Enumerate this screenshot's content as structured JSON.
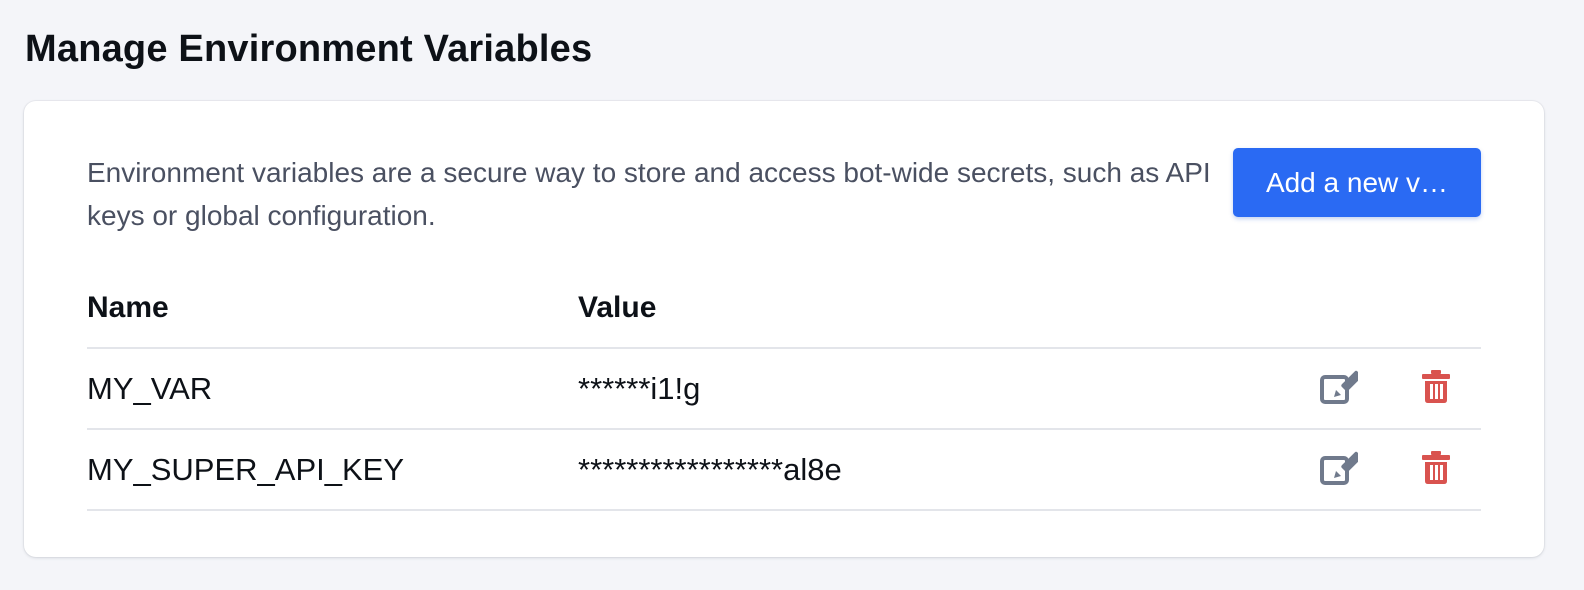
{
  "page": {
    "title": "Manage Environment Variables"
  },
  "panel": {
    "description": "Environment variables are a secure way to store and access bot-wide secrets, such as API keys or global configuration.",
    "add_button_label": "Add a new v…"
  },
  "table": {
    "columns": {
      "name": "Name",
      "value": "Value"
    },
    "rows": [
      {
        "name": "MY_VAR",
        "value": "******i1!g"
      },
      {
        "name": "MY_SUPER_API_KEY",
        "value": "*****************al8e"
      }
    ]
  },
  "icons": {
    "edit": "edit-icon",
    "delete": "trash-icon"
  },
  "colors": {
    "page_background": "#f4f5f9",
    "card_background": "#ffffff",
    "primary_button": "#2a6af3",
    "edit_icon": "#707a8c",
    "delete_icon": "#d9534f",
    "divider": "#e3e5ea"
  }
}
